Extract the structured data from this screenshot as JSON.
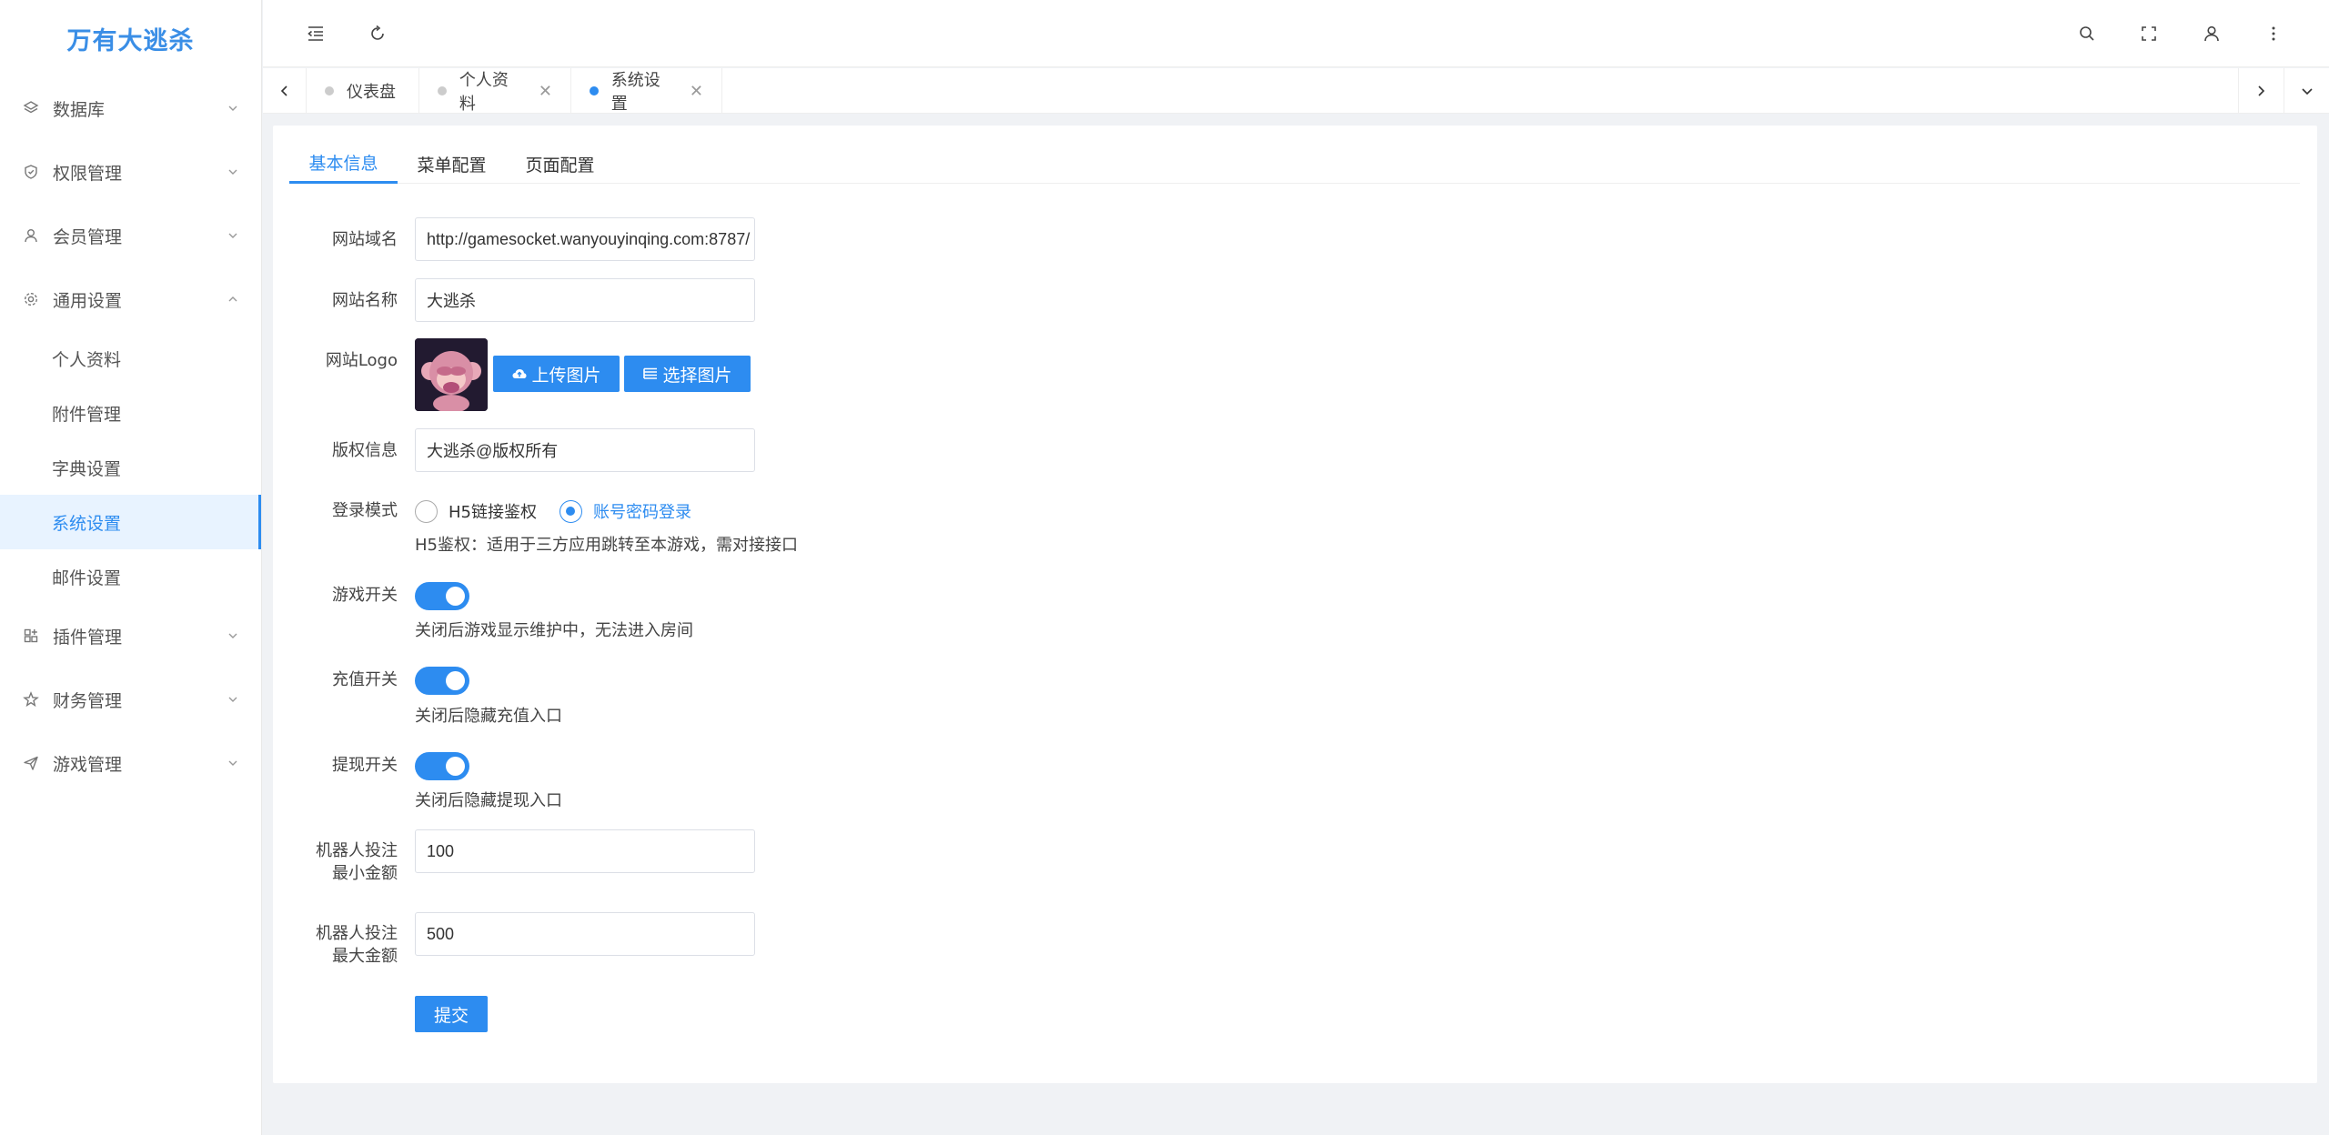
{
  "app": {
    "logo_text": "万有大逃杀"
  },
  "sidebar": {
    "items": [
      {
        "label": "数据库",
        "icon": "layers-icon"
      },
      {
        "label": "权限管理",
        "icon": "shield-icon"
      },
      {
        "label": "会员管理",
        "icon": "user-icon"
      },
      {
        "label": "通用设置",
        "icon": "gear-icon",
        "expanded": true,
        "children": [
          "个人资料",
          "附件管理",
          "字典设置",
          "系统设置",
          "邮件设置"
        ],
        "active_child": "系统设置"
      },
      {
        "label": "插件管理",
        "icon": "plugin-icon"
      },
      {
        "label": "财务管理",
        "icon": "finance-icon"
      },
      {
        "label": "游戏管理",
        "icon": "send-icon"
      }
    ]
  },
  "header": {
    "icons": [
      "menu-fold-icon",
      "refresh-icon",
      "search-icon",
      "fullscreen-icon",
      "user-icon",
      "more-icon"
    ]
  },
  "tabs": [
    {
      "label": "仪表盘",
      "closable": false,
      "active": false
    },
    {
      "label": "个人资料",
      "closable": true,
      "active": false
    },
    {
      "label": "系统设置",
      "closable": true,
      "active": true
    }
  ],
  "content_tabs": [
    {
      "label": "基本信息",
      "active": true
    },
    {
      "label": "菜单配置",
      "active": false
    },
    {
      "label": "页面配置",
      "active": false
    }
  ],
  "form": {
    "domain_label": "网站域名",
    "domain_value": "http://gamesocket.wanyouyinqing.com:8787/",
    "name_label": "网站名称",
    "name_value": "大逃杀",
    "logo_label": "网站Logo",
    "upload_button": "上传图片",
    "choose_button": "选择图片",
    "copyright_label": "版权信息",
    "copyright_value": "大逃杀@版权所有",
    "login_mode_label": "登录模式",
    "login_options": [
      "H5链接鉴权",
      "账号密码登录"
    ],
    "login_selected": "账号密码登录",
    "login_hint": "H5鉴权：适用于三方应用跳转至本游戏，需对接接口",
    "game_switch_label": "游戏开关",
    "game_switch_on": true,
    "game_switch_hint": "关闭后游戏显示维护中，无法进入房间",
    "recharge_switch_label": "充值开关",
    "recharge_switch_on": true,
    "recharge_switch_hint": "关闭后隐藏充值入口",
    "withdraw_switch_label": "提现开关",
    "withdraw_switch_on": true,
    "withdraw_switch_hint": "关闭后隐藏提现入口",
    "robot_min_label_1": "机器人投注",
    "robot_min_label_2": "最小金额",
    "robot_min_value": "100",
    "robot_max_label_1": "机器人投注",
    "robot_max_label_2": "最大金额",
    "robot_max_value": "500",
    "submit_button": "提交"
  },
  "colors": {
    "accent": "#2d8cf0",
    "logo": "#3a8ee6",
    "active_bg": "#e8f3ff"
  }
}
